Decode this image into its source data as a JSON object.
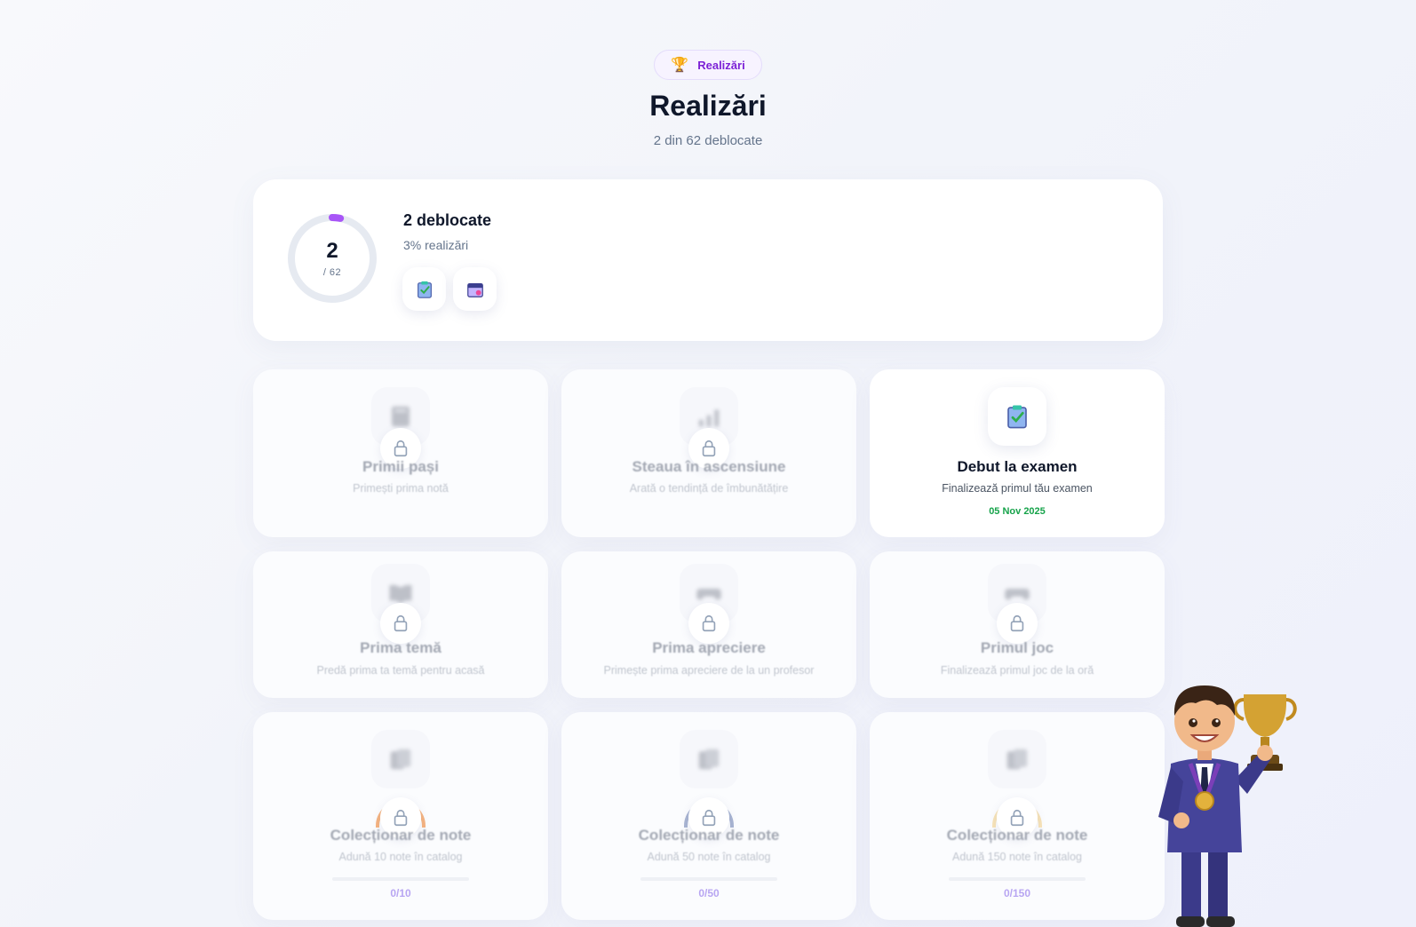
{
  "header": {
    "pill_label": "Realizări",
    "pill_icon": "trophy-icon",
    "title": "Realizări",
    "subtitle": "2 din 62 deblocate"
  },
  "summary": {
    "unlocked": "2",
    "total": "/ 62",
    "progress_fraction": 0.032,
    "title": "2 deblocate",
    "percent": "3% realizări",
    "badges": [
      "clipboard-check-icon",
      "calendar-icon"
    ],
    "accent": "#a855f7"
  },
  "achievements": [
    {
      "title": "Primii pași",
      "desc": "Primești prima notă",
      "icon": "notebook-icon",
      "locked": true
    },
    {
      "title": "Steaua în ascensiune",
      "desc": "Arată o tendință de îmbunătățire",
      "icon": "chart-up-icon",
      "locked": true
    },
    {
      "title": "Debut la examen",
      "desc": "Finalizează primul tău examen",
      "icon": "clipboard-check-icon",
      "locked": false,
      "date": "05 Nov 2025"
    },
    {
      "title": "Prima temă",
      "desc": "Predă prima ta temă pentru acasă",
      "icon": "open-book-icon",
      "locked": true
    },
    {
      "title": "Prima apreciere",
      "desc": "Primește prima apreciere de la un profesor",
      "icon": "gamepad-icon",
      "locked": true
    },
    {
      "title": "Primul joc",
      "desc": "Finalizează primul joc de la oră",
      "icon": "gamepad-icon",
      "locked": true
    },
    {
      "title": "Colecționar de note",
      "desc": "Adună 10 note în catalog",
      "icon": "cards-icon",
      "locked": true,
      "progress": "0/10",
      "tier_color": "#f4a261"
    },
    {
      "title": "Colecționar de note",
      "desc": "Adună 50 note în catalog",
      "icon": "cards-icon",
      "locked": true,
      "progress": "0/50",
      "tier_color": "#94a3c8"
    },
    {
      "title": "Colecționar de note",
      "desc": "Adună 150 note în catalog",
      "icon": "cards-icon",
      "locked": true,
      "progress": "0/150",
      "tier_color": "#f6d38a"
    }
  ],
  "mascot": "trophy-mascot-icon"
}
